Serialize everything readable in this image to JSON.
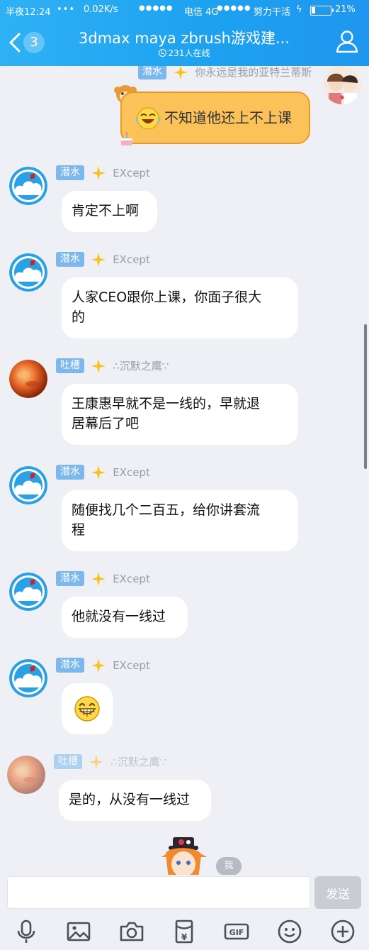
{
  "status_bar": {
    "time": "半夜12:24",
    "dots": "•••",
    "speed": "0.02K/s",
    "signal_dots": "●●●●●",
    "carrier1": "电信 4G",
    "signal_dots2": "●●●●●",
    "carrier2": "努力干活",
    "charging_glyph": "ϟ",
    "battery_level": 0.21,
    "battery_percent": "21%"
  },
  "header": {
    "unread_count": "3",
    "title": "3dmax maya zbrush游戏建...",
    "online": "231人在线",
    "icons": [
      "back-chevron-icon",
      "clock-icon",
      "group-members-icon"
    ]
  },
  "messages": [
    {
      "role": "潜水",
      "nickname": "你永远是我的亚特兰蒂斯",
      "text": "不知道他还上不上课",
      "avatar": "couple-avatar",
      "sticker": "laugh-emoji",
      "side": "right"
    },
    {
      "role": "潜水",
      "nickname": "EXcept",
      "text": "肯定不上啊",
      "avatar": "cloud-avatar"
    },
    {
      "role": "潜水",
      "nickname": "EXcept",
      "text_lines": [
        "人家CEO跟你上课，你面子很大",
        "的"
      ],
      "avatar": "cloud-avatar"
    },
    {
      "role": "吐槽",
      "nickname": "∴沉默之鹰∵",
      "text_lines": [
        "王康惠早就不是一线的，早就退",
        "居幕后了吧"
      ],
      "avatar": "planet-avatar"
    },
    {
      "role": "潜水",
      "nickname": "EXcept",
      "text_lines": [
        "随便找几个二百五，给你讲套流",
        "程"
      ],
      "avatar": "cloud-avatar"
    },
    {
      "role": "潜水",
      "nickname": "EXcept",
      "text": "他就没有一线过",
      "avatar": "cloud-avatar"
    },
    {
      "role": "潜水",
      "nickname": "EXcept",
      "emoji": "grin-emoji",
      "avatar": "cloud-avatar"
    },
    {
      "role": "吐槽",
      "nickname": "∴沉默之鹰∵",
      "text": "是的，从没有一线过",
      "avatar": "planet-avatar"
    }
  ],
  "self_tag": "我",
  "input": {
    "value": "",
    "send_label": "发送"
  },
  "toolbar": {
    "icons": [
      "microphone-icon",
      "image-icon",
      "camera-icon",
      "red-packet-icon",
      "gif-icon",
      "emoji-icon",
      "plus-icon"
    ],
    "red_packet_symbol": "¥",
    "gif_label": "GIF"
  },
  "colors": {
    "header_blue": "#1ea2f0",
    "role_badge": "#7cb8ec",
    "sticker_bubble": "#fcc25a",
    "background": "#eef0f5"
  }
}
